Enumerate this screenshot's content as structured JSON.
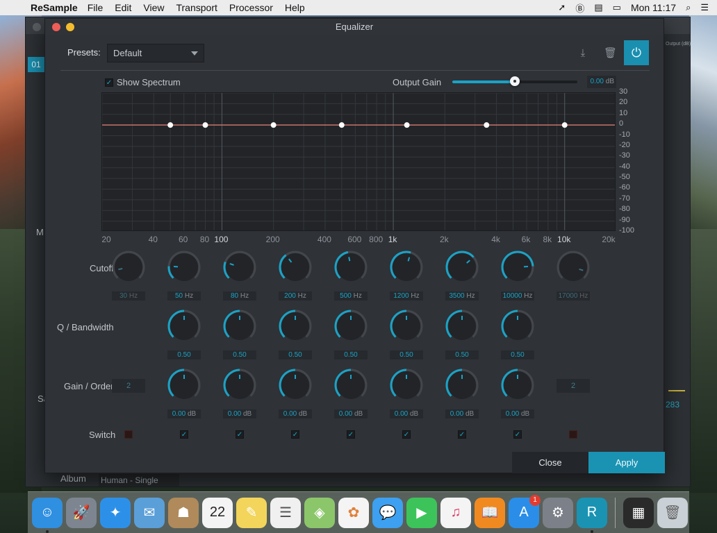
{
  "menubar": {
    "app_name": "ReSample",
    "items": [
      "File",
      "Edit",
      "View",
      "Transport",
      "Processor",
      "Help"
    ],
    "clock": "Mon 11:17"
  },
  "background_window": {
    "track_number": "01",
    "output_label": "Output (dB)",
    "side_label_m": "M",
    "side_label_sa": "Sa",
    "value_283": "283",
    "album_label": "Album",
    "album_value": "Human - Single"
  },
  "equalizer": {
    "title": "Equalizer",
    "presets_label": "Presets:",
    "preset_value": "Default",
    "show_spectrum_label": "Show Spectrum",
    "show_spectrum_checked": true,
    "output_gain_label": "Output Gain",
    "output_gain_value": "0.00",
    "output_gain_unit": "dB",
    "output_gain_fraction": 0.5,
    "db_axis": [
      "30",
      "20",
      "10",
      "0",
      "-10",
      "-20",
      "-30",
      "-40",
      "-50",
      "-60",
      "-70",
      "-80",
      "-90",
      "-100"
    ],
    "freq_axis": [
      {
        "label": "20",
        "hz": 20,
        "major": false
      },
      {
        "label": "40",
        "hz": 40,
        "major": false
      },
      {
        "label": "60",
        "hz": 60,
        "major": false
      },
      {
        "label": "80",
        "hz": 80,
        "major": false
      },
      {
        "label": "100",
        "hz": 100,
        "major": true
      },
      {
        "label": "200",
        "hz": 200,
        "major": false
      },
      {
        "label": "400",
        "hz": 400,
        "major": false
      },
      {
        "label": "600",
        "hz": 600,
        "major": false
      },
      {
        "label": "800",
        "hz": 800,
        "major": false
      },
      {
        "label": "1k",
        "hz": 1000,
        "major": true
      },
      {
        "label": "2k",
        "hz": 2000,
        "major": false
      },
      {
        "label": "4k",
        "hz": 4000,
        "major": false
      },
      {
        "label": "6k",
        "hz": 6000,
        "major": false
      },
      {
        "label": "8k",
        "hz": 8000,
        "major": false
      },
      {
        "label": "10k",
        "hz": 10000,
        "major": true
      },
      {
        "label": "20k",
        "hz": 20000,
        "major": false
      }
    ],
    "curve_gain_db": 0,
    "rows": {
      "cutoff_label": "Cutoff",
      "q_label": "Q / Bandwidth",
      "gain_label": "Gain / Order",
      "switch_label": "Switch"
    },
    "bands": [
      {
        "cutoff": "30",
        "cutoff_unit": "Hz",
        "hz": 30,
        "enabled": false,
        "type": "lowcut",
        "order": "2",
        "cutoff_fraction": 0.12
      },
      {
        "cutoff": "50",
        "cutoff_unit": "Hz",
        "hz": 50,
        "enabled": true,
        "type": "peak",
        "q": "0.50",
        "gain": "0.00",
        "gain_unit": "dB",
        "cutoff_fraction": 0.18,
        "q_fraction": 0.5,
        "gain_fraction": 0.5
      },
      {
        "cutoff": "80",
        "cutoff_unit": "Hz",
        "hz": 80,
        "enabled": true,
        "type": "peak",
        "q": "0.50",
        "gain": "0.00",
        "gain_unit": "dB",
        "cutoff_fraction": 0.24,
        "q_fraction": 0.5,
        "gain_fraction": 0.5
      },
      {
        "cutoff": "200",
        "cutoff_unit": "Hz",
        "hz": 200,
        "enabled": true,
        "type": "peak",
        "q": "0.50",
        "gain": "0.00",
        "gain_unit": "dB",
        "cutoff_fraction": 0.36,
        "q_fraction": 0.5,
        "gain_fraction": 0.5
      },
      {
        "cutoff": "500",
        "cutoff_unit": "Hz",
        "hz": 500,
        "enabled": true,
        "type": "peak",
        "q": "0.50",
        "gain": "0.00",
        "gain_unit": "dB",
        "cutoff_fraction": 0.46,
        "q_fraction": 0.5,
        "gain_fraction": 0.5
      },
      {
        "cutoff": "1200",
        "cutoff_unit": "Hz",
        "hz": 1200,
        "enabled": true,
        "type": "peak",
        "q": "0.50",
        "gain": "0.00",
        "gain_unit": "dB",
        "cutoff_fraction": 0.56,
        "q_fraction": 0.5,
        "gain_fraction": 0.5
      },
      {
        "cutoff": "3500",
        "cutoff_unit": "Hz",
        "hz": 3500,
        "enabled": true,
        "type": "peak",
        "q": "0.50",
        "gain": "0.00",
        "gain_unit": "dB",
        "cutoff_fraction": 0.68,
        "q_fraction": 0.5,
        "gain_fraction": 0.5
      },
      {
        "cutoff": "10000",
        "cutoff_unit": "Hz",
        "hz": 10000,
        "enabled": true,
        "type": "peak",
        "q": "0.50",
        "gain": "0.00",
        "gain_unit": "dB",
        "cutoff_fraction": 0.82,
        "q_fraction": 0.5,
        "gain_fraction": 0.5
      },
      {
        "cutoff": "17000",
        "cutoff_unit": "Hz",
        "hz": 17000,
        "enabled": false,
        "type": "highcut",
        "order": "2",
        "cutoff_fraction": 0.9
      }
    ],
    "close_label": "Close",
    "apply_label": "Apply"
  },
  "dock": {
    "apps": [
      {
        "name": "finder-icon",
        "glyph": "☺",
        "color": "#2f8fe0",
        "running": true
      },
      {
        "name": "launchpad-icon",
        "glyph": "🚀",
        "color": "#7d8591"
      },
      {
        "name": "safari-icon",
        "glyph": "✦",
        "color": "#2d90e8"
      },
      {
        "name": "mail-icon",
        "glyph": "✉",
        "color": "#5a9fd8"
      },
      {
        "name": "contacts-icon",
        "glyph": "☗",
        "color": "#b08a5a"
      },
      {
        "name": "calendar-icon",
        "glyph": "22",
        "color": "#f4f4f4",
        "text_color": "#222"
      },
      {
        "name": "notes-icon",
        "glyph": "✎",
        "color": "#f2d55a"
      },
      {
        "name": "reminders-icon",
        "glyph": "☰",
        "color": "#f0f0f0",
        "text_color": "#555"
      },
      {
        "name": "maps-icon",
        "glyph": "◈",
        "color": "#8cc66a"
      },
      {
        "name": "photos-icon",
        "glyph": "✿",
        "color": "#f4f4f4",
        "text_color": "#e0803a"
      },
      {
        "name": "messages-icon",
        "glyph": "💬",
        "color": "#3da0f0"
      },
      {
        "name": "facetime-icon",
        "glyph": "▶",
        "color": "#3cc45a"
      },
      {
        "name": "itunes-icon",
        "glyph": "♫",
        "color": "#f4f4f4",
        "text_color": "#e03a6a"
      },
      {
        "name": "ibooks-icon",
        "glyph": "📖",
        "color": "#f08a20"
      },
      {
        "name": "app-store-icon",
        "glyph": "A",
        "color": "#2a8ee8",
        "badge": "1"
      },
      {
        "name": "system-preferences-icon",
        "glyph": "⚙",
        "color": "#7c8088"
      },
      {
        "name": "resample-icon",
        "glyph": "R",
        "color": "#1a93b3",
        "running": true
      }
    ],
    "extras": [
      {
        "name": "minimized-window-icon",
        "glyph": "▦",
        "color": "#2a2a2a"
      },
      {
        "name": "trash-icon",
        "glyph": "🗑",
        "color": "#c9d0d6",
        "text_color": "#666"
      }
    ]
  }
}
